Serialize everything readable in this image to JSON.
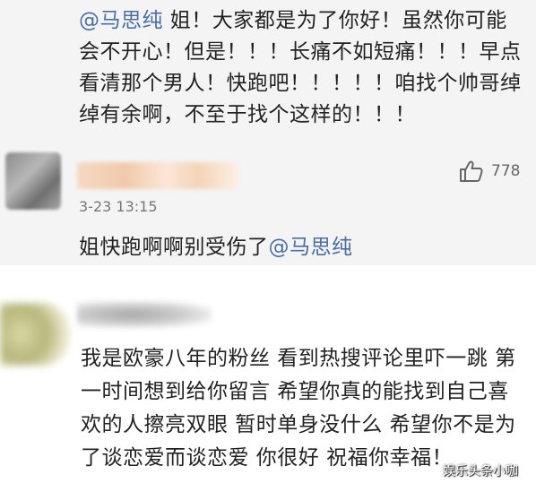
{
  "top_comment": {
    "mention": "@马思纯",
    "text": " 姐！大家都是为了你好！虽然你可能会不开心！但是！！！长痛不如短痛！！！早点看清那个男人！快跑吧！！！！！咱找个帅哥绰绰有余啊，不至于找个这样的！！！"
  },
  "comment1": {
    "avatar_icon": "blurred-avatar-icon",
    "like_icon": "thumbs-up-icon",
    "like_count": "778",
    "timestamp": "3-23 13:15",
    "text": "姐快跑啊啊别受伤了",
    "mention": "@马思纯"
  },
  "comment2": {
    "avatar_icon": "blurred-avatar-icon",
    "text": "我是欧豪八年的粉丝 看到热搜评论里吓一跳 第一时间想到给你留言 希望你真的能找到自己喜欢的人擦亮双眼 暂时单身没什么 希望你不是为了谈恋爱而谈恋爱 你很好 祝福你幸福！"
  },
  "watermark": "娱乐头条小咖",
  "colors": {
    "mention": "#4a6ea9",
    "panel_bg": "#f4f4f4"
  }
}
